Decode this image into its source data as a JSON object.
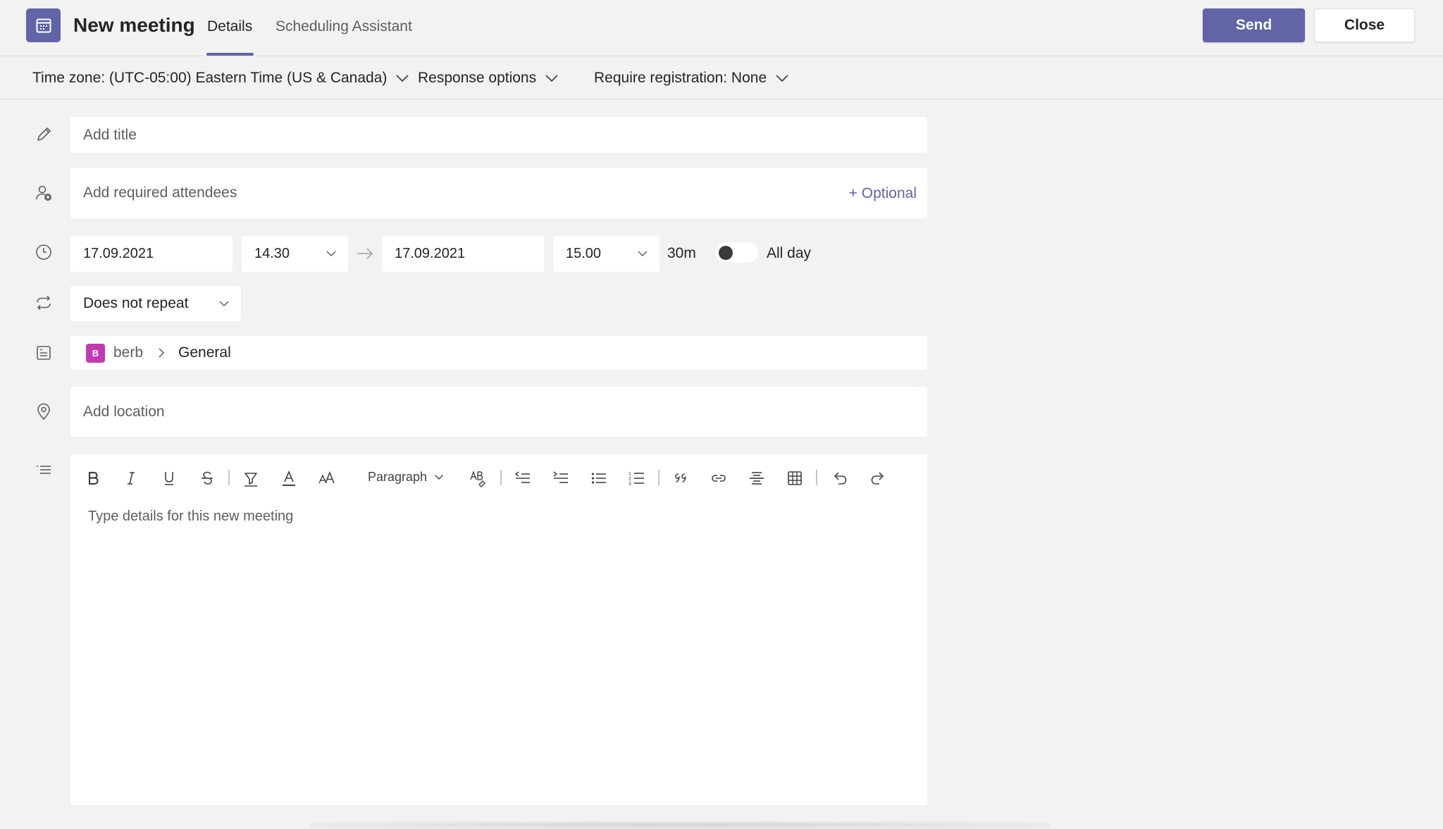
{
  "header": {
    "title": "New meeting",
    "tabs": [
      {
        "label": "Details",
        "active": true
      },
      {
        "label": "Scheduling Assistant",
        "active": false
      }
    ],
    "send_label": "Send",
    "close_label": "Close",
    "icon": "calendar-icon"
  },
  "options": {
    "timezone": "Time zone: (UTC-05:00) Eastern Time (US & Canada)",
    "response": "Response options",
    "registration": "Require registration: None"
  },
  "form": {
    "title_placeholder": "Add title",
    "attendees_placeholder": "Add required attendees",
    "optional_label": "+ Optional",
    "start_date": "17.09.2021",
    "start_time": "14.30",
    "end_date": "17.09.2021",
    "end_time": "15.00",
    "duration": "30m",
    "all_day_label": "All day",
    "repeat": "Does not repeat",
    "team_initial": "B",
    "team_name": "berb",
    "channel_name": "General",
    "location_placeholder": "Add location"
  },
  "editor": {
    "paragraph_label": "Paragraph",
    "placeholder": "Type details for this new meeting"
  },
  "colors": {
    "accent": "#6264a7",
    "team_badge": "#c239b3"
  }
}
